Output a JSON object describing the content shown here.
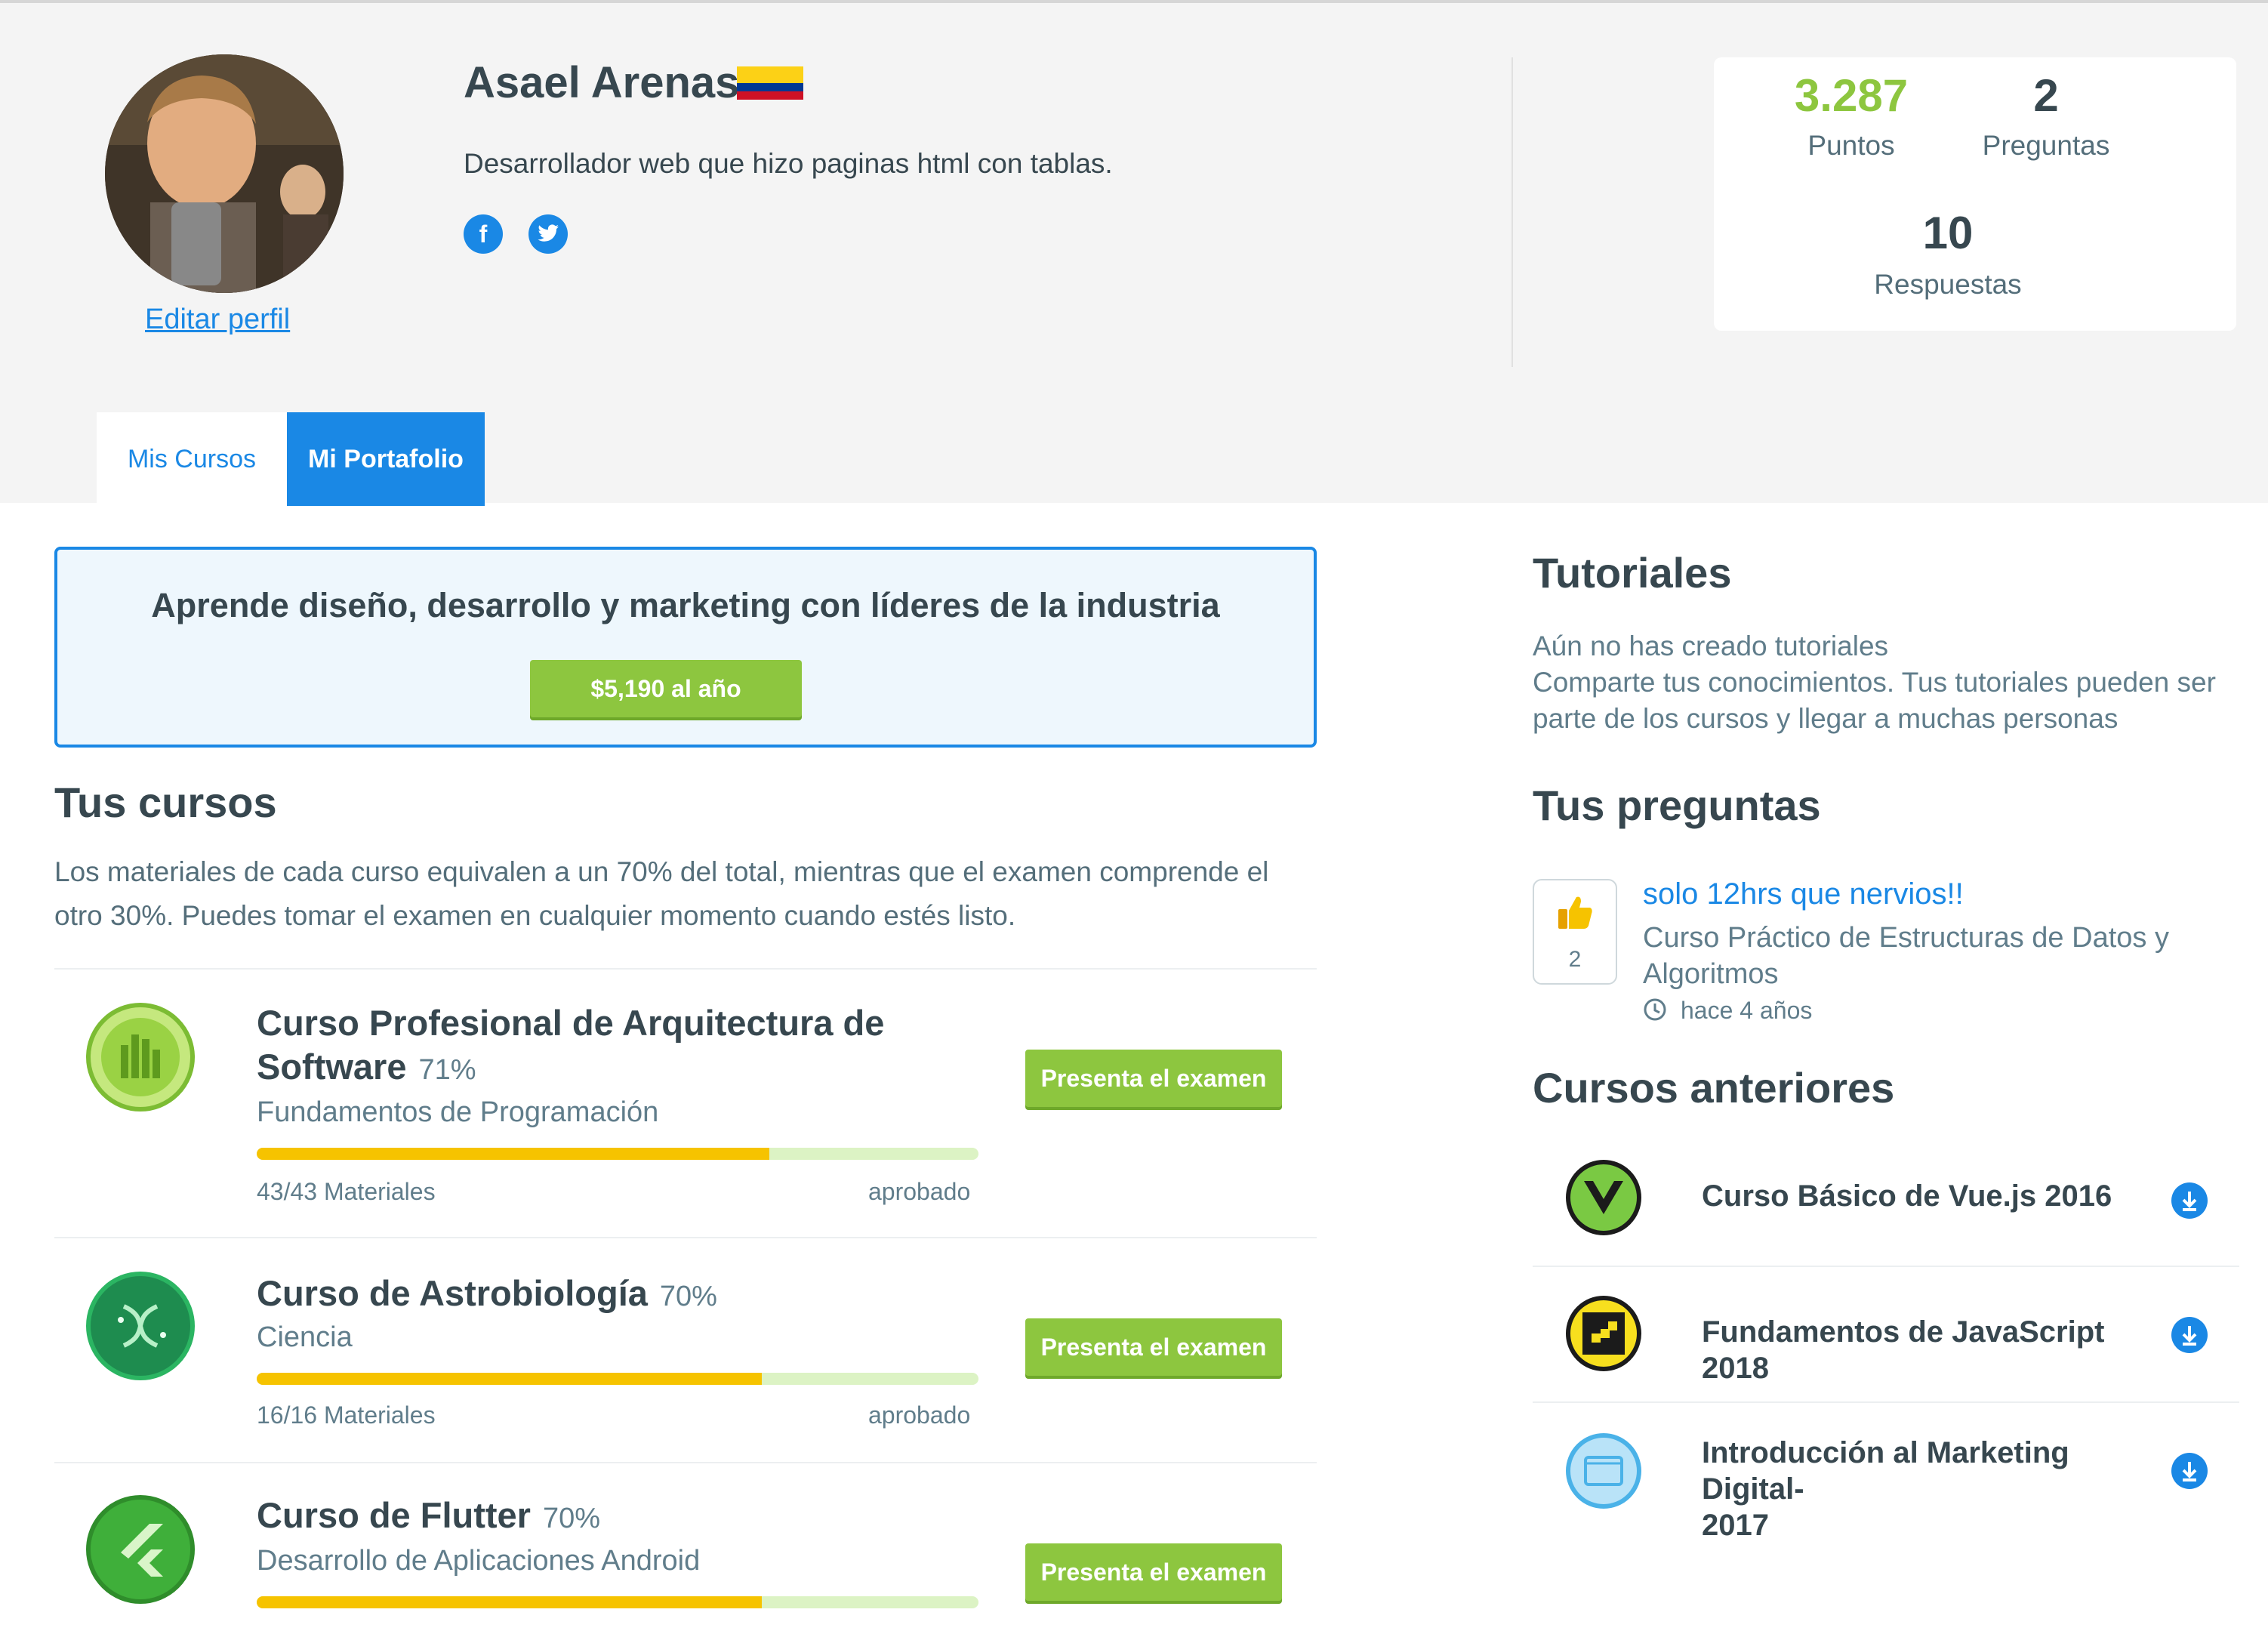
{
  "profile": {
    "name": "Asael Arenas",
    "bio": "Desarrollador web que hizo paginas html con tablas.",
    "edit_label": "Editar perfil",
    "social": [
      "facebook-icon",
      "twitter-icon"
    ]
  },
  "stats": {
    "points_value": "3.287",
    "points_label": "Puntos",
    "questions_value": "2",
    "questions_label": "Preguntas",
    "answers_value": "10",
    "answers_label": "Respuestas"
  },
  "tabs": [
    {
      "label": "Mis Cursos",
      "active": false
    },
    {
      "label": "Mi Portafolio",
      "active": true
    }
  ],
  "promo": {
    "title": "Aprende diseño, desarrollo y marketing con líderes de la industria",
    "button": "$5,190 al año"
  },
  "courses_section": {
    "title": "Tus cursos",
    "description_line1": "Los materiales de cada curso equivalen a un 70% del total, mientras que el examen comprende el",
    "description_line2": "otro 30%. Puedes tomar el examen en cualquier momento cuando estés listo.",
    "courses": [
      {
        "title_line1": "Curso Profesional de Arquitectura de",
        "title_line2": "Software",
        "percent": "71%",
        "category": "Fundamentos de Programación",
        "materials_count": "43/43",
        "materials_label": "Materiales",
        "status": "aprobado",
        "progress": 0.71,
        "button": "Presenta el examen"
      },
      {
        "title_line1": "Curso de Astrobiología",
        "title_line2": "",
        "percent": "70%",
        "category": "Ciencia",
        "materials_count": "16/16",
        "materials_label": "Materiales",
        "status": "aprobado",
        "progress": 0.7,
        "button": "Presenta el examen"
      },
      {
        "title_line1": "Curso de Flutter",
        "title_line2": "",
        "percent": "70%",
        "category": "Desarrollo de Aplicaciones Android",
        "progress": 0.7,
        "button": "Presenta el examen"
      }
    ]
  },
  "tutorials": {
    "title": "Tutoriales",
    "empty_line1": "Aún no has creado tutoriales",
    "empty_line2": "Comparte tus conocimientos. Tus tutoriales pueden ser",
    "empty_line3": "parte de los cursos y llegar a muchas personas"
  },
  "questions": {
    "title": "Tus preguntas",
    "items": [
      {
        "votes": "2",
        "title": "solo 12hrs que nervios!!",
        "course_line1": "Curso Práctico de Estructuras de Datos y",
        "course_line2": "Algoritmos",
        "time": "hace 4 años"
      }
    ]
  },
  "previous_courses": {
    "title": "Cursos anteriores",
    "items": [
      {
        "title_line1": "Curso Básico de Vue.js 2016",
        "title_line2": ""
      },
      {
        "title_line1": "Fundamentos de JavaScript 2018",
        "title_line2": ""
      },
      {
        "title_line1": "Introducción al Marketing Digital-",
        "title_line2": "2017"
      }
    ]
  },
  "colors": {
    "accent": "#1a88e5",
    "points": "#8dc63f",
    "button_green": "#8dc63f",
    "progress_fill": "#f6c300",
    "progress_track": "#dcf3c4"
  }
}
